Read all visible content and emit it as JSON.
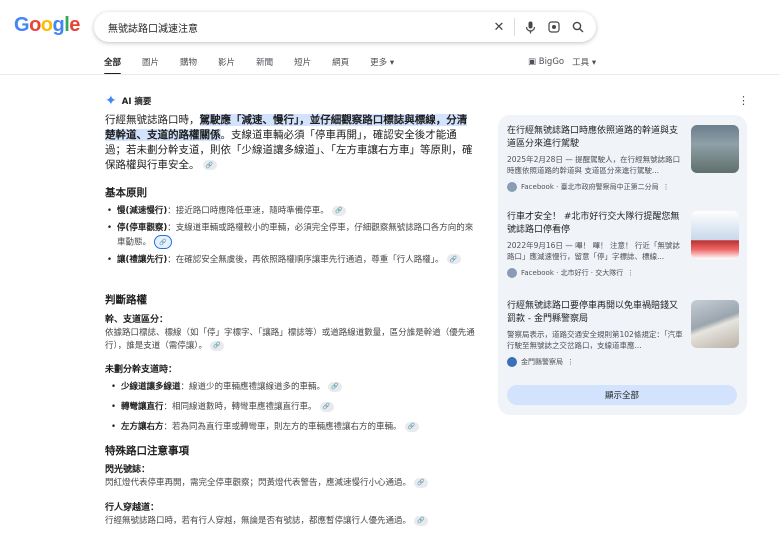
{
  "header": {
    "logo_letters": [
      {
        "ch": "G",
        "cls": "b"
      },
      {
        "ch": "o",
        "cls": "r"
      },
      {
        "ch": "o",
        "cls": "y"
      },
      {
        "ch": "g",
        "cls": "b"
      },
      {
        "ch": "l",
        "cls": "g"
      },
      {
        "ch": "e",
        "cls": "r"
      }
    ],
    "query": "無號誌路口減速注意"
  },
  "tabs": [
    "全部",
    "圖片",
    "購物",
    "影片",
    "新聞",
    "短片",
    "網頁",
    "更多"
  ],
  "tools": {
    "bigggo": "BigGo",
    "tools_label": "工具"
  },
  "ai": {
    "label": "AI 摘要",
    "intro_a": "行經無號誌路口時，",
    "intro_hl": "駕駛應「減速、慢行」，並仔細觀察路口標誌與標線，分清楚幹道、支道的路權關係",
    "intro_b": "。支線道車輛必須「停車再開」，確認安全後才能通過；若未劃分幹支道，則依「少線道讓多線道」、「左方車讓右方車」等原則，確保路權與行車安全。",
    "section1": "基本原則",
    "principles": [
      {
        "term": "慢(減速慢行)",
        "text": "：接近路口時應降低車速，隨時準備停車。"
      },
      {
        "term": "停(停車觀察)",
        "text": "：支線道車輛或路權較小的車輛，必須完全停車，仔細觀察無號誌路口各方向的來車動態。"
      },
      {
        "term": "讓(禮讓先行)",
        "text": "：在確認安全無虞後，再依照路權順序讓車先行通過，尊重「行人路權」。"
      }
    ],
    "section2": "判斷路權",
    "sub1": "幹、支道區分：",
    "sub1_text": "依據路口標誌、標線（如「停」字標字、「讓路」標誌等）或道路線道數量，區分誰是幹道（優先通行），誰是支道（需停讓）。",
    "sub2": "未劃分幹支道時：",
    "rules": [
      {
        "term": "少線道讓多線道",
        "text": "：線道少的車輛應禮讓線道多的車輛。"
      },
      {
        "term": "轉彎讓直行",
        "text": "：相同線道數時，轉彎車應禮讓直行車。"
      },
      {
        "term": "左方讓右方",
        "text": "：若為同為直行車或轉彎車，則左方的車輛應禮讓右方的車輛。"
      }
    ],
    "section3": "特殊路口注意事項",
    "sub3": "閃光號誌：",
    "sub3_text": "閃紅燈代表停車再開，需完全停車觀察；閃黃燈代表警告，應減速慢行小心通過。",
    "sub4": "行人穿越道：",
    "sub4_text": "行經無號誌路口時，若有行人穿越，無論是否有號誌，都應暫停讓行人優先通過。"
  },
  "sources": [
    {
      "title": "在行經無號誌路口時應依照道路的幹道與支道區分來進行駕駛",
      "snippet": "2025年2月28日 — 提醒駕駛人，在行經無號誌路口時應依照道路的幹道與 支道區分來進行駕駛...",
      "site": "Facebook · 臺北市政府警察局中正第二分局"
    },
    {
      "title": "行車才安全！ #北市好行交大隊行提醒您無號誌路口停看停",
      "snippet": "2022年9月16日 — 嗶！ 嗶！ 注意！ 行近「無號誌路口」應減速慢行，留意「停」字標誌、標線...",
      "site": "Facebook · 北市好行 · 交大隊行"
    },
    {
      "title": "行經無號誌路口要停車再開以免車禍賠錢又罰款 - 金門縣警察局",
      "snippet": "警察局表示，道路交通安全規則第102條規定：「汽車行駛至無號誌之交岔路口，支線道車應...",
      "site": "金門縣警察局"
    }
  ],
  "show_all": "顯示全部"
}
